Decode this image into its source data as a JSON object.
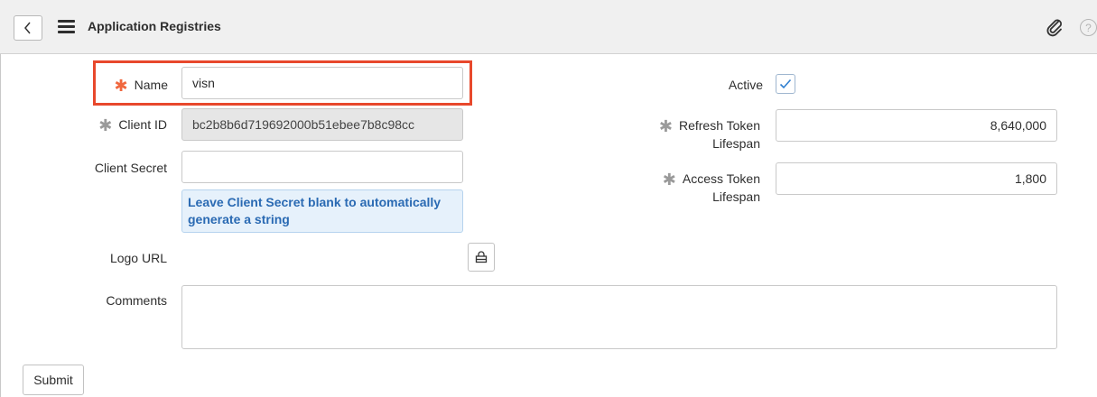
{
  "header": {
    "title": "Application Registries",
    "back_icon": "chevron-left-icon",
    "menu_icon": "hamburger-icon",
    "attachment_icon": "paperclip-icon",
    "help_icon": "help-icon",
    "help_glyph": "?"
  },
  "form": {
    "name": {
      "label": "Name",
      "value": "visn",
      "required": true
    },
    "client_id": {
      "label": "Client ID",
      "value": "bc2b8b6d719692000b51ebee7b8c98cc"
    },
    "client_secret": {
      "label": "Client Secret",
      "value": ""
    },
    "client_secret_hint": "Leave Client Secret blank to automatically generate a string",
    "logo_url": {
      "label": "Logo URL",
      "lock_icon": "lock-icon"
    },
    "comments": {
      "label": "Comments",
      "value": ""
    },
    "active": {
      "label": "Active",
      "checked": true
    },
    "refresh_token_lifespan": {
      "label": "Refresh Token Lifespan",
      "value": "8,640,000"
    },
    "access_token_lifespan": {
      "label": "Access Token Lifespan",
      "value": "1,800"
    },
    "submit_label": "Submit"
  },
  "colors": {
    "required_star": "#f0673e",
    "highlight_border": "#e8482c",
    "hint_text": "#2a6ab3",
    "hint_background": "#e6f1fb"
  }
}
